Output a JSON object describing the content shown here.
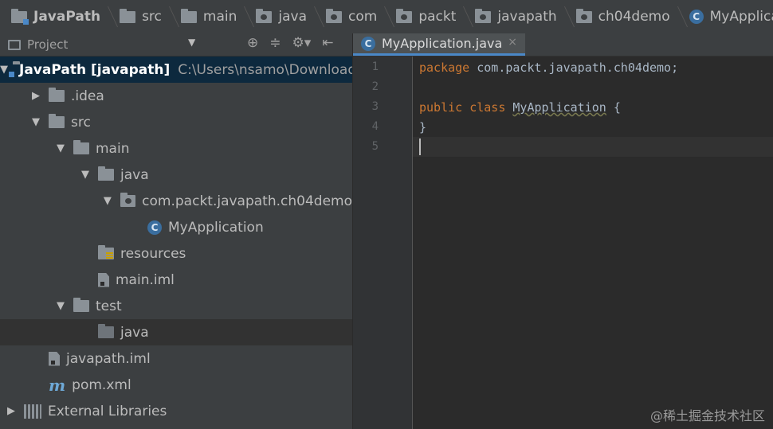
{
  "breadcrumbs": [
    {
      "label": "JavaPath",
      "icon": "module-folder-icon",
      "bold": true
    },
    {
      "label": "src",
      "icon": "folder-icon"
    },
    {
      "label": "main",
      "icon": "folder-icon"
    },
    {
      "label": "java",
      "icon": "source-folder-icon"
    },
    {
      "label": "com",
      "icon": "package-icon"
    },
    {
      "label": "packt",
      "icon": "package-icon"
    },
    {
      "label": "javapath",
      "icon": "package-icon"
    },
    {
      "label": "ch04demo",
      "icon": "package-icon"
    },
    {
      "label": "MyApplication",
      "icon": "class-icon"
    }
  ],
  "project_panel": {
    "title": "Project",
    "dropdown": "▼",
    "tools": [
      "⊕",
      "≑",
      "⚙▾",
      "⇤"
    ]
  },
  "tree": [
    {
      "label": "JavaPath",
      "bold_label": "JavaPath [javapath]",
      "path": "C:\\Users\\nsamo\\Downloads",
      "depth": 0,
      "arrow": "▼",
      "icon": "module"
    },
    {
      "label": ".idea",
      "depth": 1,
      "arrow": "▶",
      "icon": "folder"
    },
    {
      "label": "src",
      "depth": 1,
      "arrow": "▼",
      "icon": "folder"
    },
    {
      "label": "main",
      "depth": 2,
      "arrow": "▼",
      "icon": "folder"
    },
    {
      "label": "java",
      "depth": 3,
      "arrow": "▼",
      "icon": "folder"
    },
    {
      "label": "com.packt.javapath.ch04demo",
      "depth": 4,
      "arrow": "▼",
      "icon": "package"
    },
    {
      "label": "MyApplication",
      "depth": 5,
      "arrow": "",
      "icon": "class"
    },
    {
      "label": "resources",
      "depth": 3,
      "arrow": "",
      "icon": "resources"
    },
    {
      "label": "main.iml",
      "depth": 3,
      "arrow": "",
      "icon": "file"
    },
    {
      "label": "test",
      "depth": 2,
      "arrow": "▼",
      "icon": "folder"
    },
    {
      "label": "java",
      "depth": 3,
      "arrow": "",
      "icon": "folder-dark"
    },
    {
      "label": "javapath.iml",
      "depth": 1,
      "arrow": "",
      "icon": "file"
    },
    {
      "label": "pom.xml",
      "depth": 1,
      "arrow": "",
      "icon": "maven"
    },
    {
      "label": "External Libraries",
      "depth": 0,
      "arrow": "▶",
      "icon": "library"
    }
  ],
  "editor": {
    "tab_label": "MyApplication.java",
    "tab_close": "×",
    "tab_icon": "C",
    "line_numbers": [
      "1",
      "2",
      "3",
      "4",
      "5"
    ],
    "lines": [
      {
        "kw": "package",
        "rest": " com.packt.javapath.ch04demo;"
      },
      {
        "kw": "",
        "rest": ""
      },
      {
        "kw": "public class",
        "cls": "MyApplication",
        "rest": " {"
      },
      {
        "kw": "",
        "rest": "}"
      },
      {
        "kw": "",
        "rest": ""
      }
    ]
  },
  "watermark": "@稀土掘金技术社区",
  "colors": {
    "keyword": "#cc7832",
    "text": "#a9b7c6",
    "selection": "#0d293e",
    "accent": "#4a88c7"
  }
}
